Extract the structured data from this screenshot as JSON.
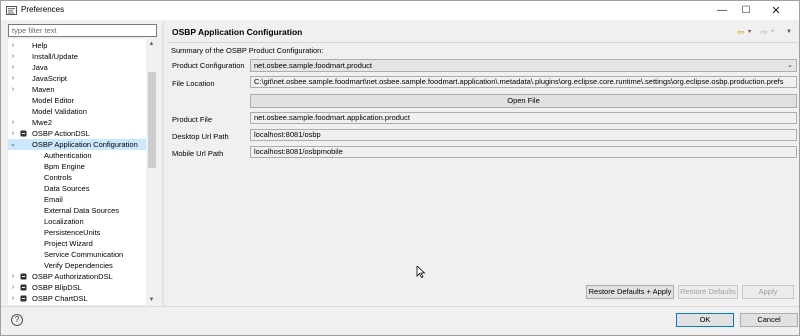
{
  "window": {
    "title": "Preferences",
    "min_glyph": "—",
    "max_glyph": "☐",
    "close_glyph": "✕"
  },
  "filter": {
    "placeholder": "type filter text"
  },
  "tree": {
    "items": [
      {
        "label": "Help",
        "arrow": "›",
        "icon": ""
      },
      {
        "label": "Install/Update",
        "arrow": "›",
        "icon": ""
      },
      {
        "label": "Java",
        "arrow": "›",
        "icon": ""
      },
      {
        "label": "JavaScript",
        "arrow": "›",
        "icon": ""
      },
      {
        "label": "Maven",
        "arrow": "›",
        "icon": ""
      },
      {
        "label": "Model Editor",
        "arrow": "",
        "icon": ""
      },
      {
        "label": "Model Validation",
        "arrow": "",
        "icon": ""
      },
      {
        "label": "Mwe2",
        "arrow": "›",
        "icon": ""
      },
      {
        "label": "OSBP ActionDSL",
        "arrow": "›",
        "icon": "actiondsl-icon"
      },
      {
        "label": "OSBP Application Configuration",
        "arrow": "⌄",
        "icon": "",
        "selected": true
      },
      {
        "label": "Authentication",
        "arrow": "",
        "icon": "",
        "child": true
      },
      {
        "label": "Bpm Engine",
        "arrow": "",
        "icon": "",
        "child": true
      },
      {
        "label": "Controls",
        "arrow": "",
        "icon": "",
        "child": true
      },
      {
        "label": "Data Sources",
        "arrow": "",
        "icon": "",
        "child": true
      },
      {
        "label": "Email",
        "arrow": "",
        "icon": "",
        "child": true
      },
      {
        "label": "External Data Sources",
        "arrow": "",
        "icon": "",
        "child": true
      },
      {
        "label": "Localization",
        "arrow": "",
        "icon": "",
        "child": true
      },
      {
        "label": "PersistenceUnits",
        "arrow": "",
        "icon": "",
        "child": true
      },
      {
        "label": "Project Wizard",
        "arrow": "",
        "icon": "",
        "child": true
      },
      {
        "label": "Service Communication",
        "arrow": "",
        "icon": "",
        "child": true
      },
      {
        "label": "Verify Dependencies",
        "arrow": "",
        "icon": "",
        "child": true
      },
      {
        "label": "OSBP AuthorizationDSL",
        "arrow": "›",
        "icon": "authorizationdsl-icon"
      },
      {
        "label": "OSBP BlipDSL",
        "arrow": "›",
        "icon": "blipdsl-icon"
      },
      {
        "label": "OSBP ChartDSL",
        "arrow": "›",
        "icon": "chartdsl-icon"
      }
    ]
  },
  "page": {
    "title": "OSBP Application Configuration",
    "summary": "Summary of the OSBP Product Configuration:",
    "product_configuration": {
      "label": "Product Configuration",
      "value": "net.osbee.sample.foodmart.product"
    },
    "file_location": {
      "label": "File Location",
      "value": "C:\\git\\net.osbee.sample.foodmart\\net.osbee.sample.foodmart.application\\.metadata\\.plugins\\org.eclipse.core.runtime\\.settings\\org.eclipse.osbp.production.prefs"
    },
    "open_file_label": "Open File",
    "product_file": {
      "label": "Product File",
      "value": "net.osbee.sample.foodmart.application.product"
    },
    "desktop_url": {
      "label": "Desktop Url Path",
      "value": "localhost:8081/osbp"
    },
    "mobile_url": {
      "label": "Mobile Url Path",
      "value": "localhost:8081/osbpmobile"
    }
  },
  "buttons": {
    "restore_apply": "Restore Defaults + Apply",
    "restore_defaults": "Restore Defaults",
    "apply": "Apply",
    "ok": "OK",
    "cancel": "Cancel",
    "help": "?"
  },
  "colors": {
    "selection": "#cce8ff",
    "accent": "#0078d7"
  }
}
